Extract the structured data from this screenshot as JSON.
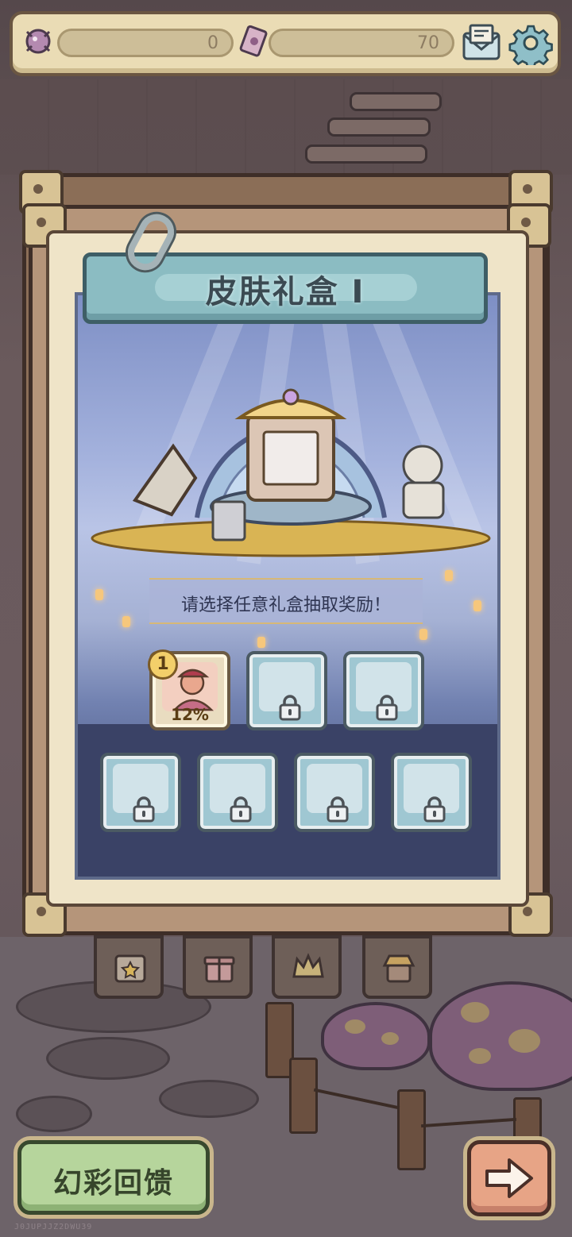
{
  "resources": {
    "currency_a": {
      "icon": "candy-currency-icon",
      "value": "0"
    },
    "currency_b": {
      "icon": "skin-ticket-icon",
      "value": "70"
    }
  },
  "top_buttons": {
    "mail_icon": "mail-icon",
    "settings_icon": "gear-icon"
  },
  "panel": {
    "title": "皮肤礼盒 I",
    "prompt": "请选择任意礼盒抽取奖励！"
  },
  "gift_boxes": [
    {
      "state": "unlocked",
      "count": "1",
      "chance": "12%",
      "icon": "hero-skin-portrait"
    },
    {
      "state": "locked",
      "icon": "lock-icon"
    },
    {
      "state": "locked",
      "icon": "lock-icon"
    },
    {
      "state": "locked",
      "icon": "lock-icon"
    },
    {
      "state": "locked",
      "icon": "lock-icon"
    },
    {
      "state": "locked",
      "icon": "lock-icon"
    },
    {
      "state": "locked",
      "icon": "lock-icon"
    }
  ],
  "bottom_tabs": [
    {
      "icon": "calendar-star-icon"
    },
    {
      "icon": "gift-icon"
    },
    {
      "icon": "crown-icon"
    },
    {
      "icon": "shop-icon"
    }
  ],
  "bottom_buttons": {
    "feedback_label": "幻彩回馈",
    "next_icon": "arrow-right-icon"
  },
  "footer": {
    "watermark": "J0JUPJJZ2DWU39"
  },
  "colors": {
    "banner": "#8bbcc2",
    "paper": "#efe4c8",
    "feedback": "#b6d59c",
    "next": "#e7a486"
  }
}
